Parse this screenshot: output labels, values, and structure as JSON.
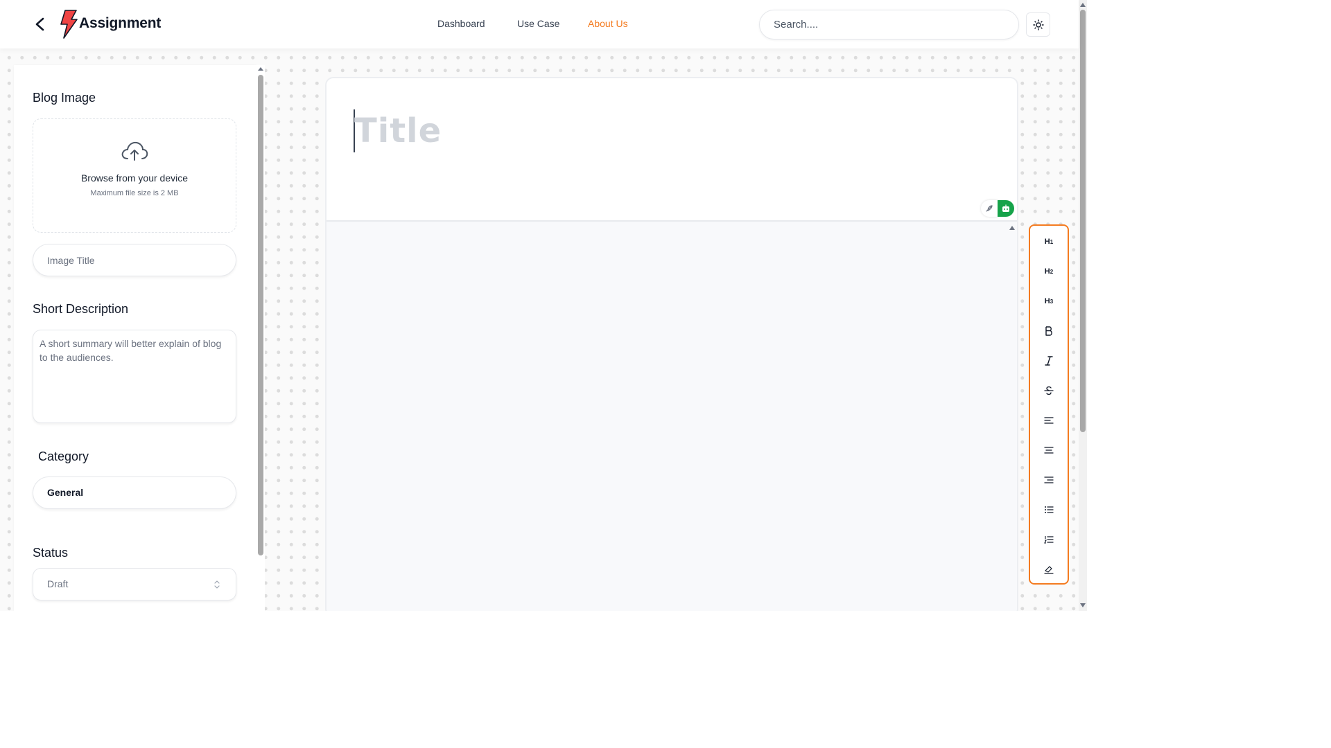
{
  "header": {
    "brand": "Assignment",
    "nav": [
      {
        "label": "Dashboard",
        "active": false
      },
      {
        "label": "Use Case",
        "active": false
      },
      {
        "label": "About Us",
        "active": true
      }
    ],
    "search_placeholder": "Search....",
    "accent_color": "#f47b20",
    "logo_color": "#ef4444"
  },
  "sidebar": {
    "blog_image_label": "Blog Image",
    "upload_text": "Browse from your device",
    "upload_subtext": "Maximum file size is 2 MB",
    "image_title_placeholder": "Image Title",
    "short_description_label": "Short Description",
    "short_description_placeholder": "A short summary will better explain of blog to the audiences.",
    "category_label": "Category",
    "category_value": "General",
    "status_label": "Status",
    "status_value": "Draft"
  },
  "editor": {
    "title_placeholder": "Title",
    "ai_tool_color": "#16a34a"
  },
  "toolbar": {
    "items": [
      "heading-1",
      "heading-2",
      "heading-3",
      "bold",
      "italic",
      "strikethrough",
      "align-left",
      "align-center",
      "align-right",
      "bullet-list",
      "ordered-list",
      "clear-format"
    ]
  }
}
